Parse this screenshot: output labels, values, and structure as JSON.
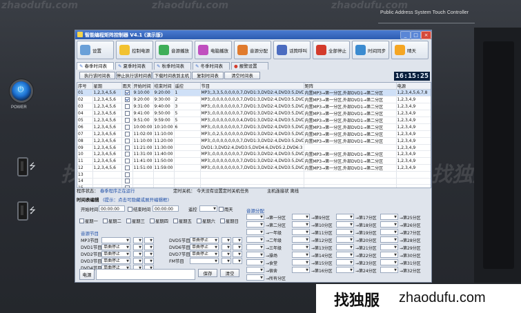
{
  "device": {
    "title": "Public Address System Touch Controller",
    "power_label": "POWER"
  },
  "watermarks": {
    "site": "zhaodufu.com",
    "brand": "找独服"
  },
  "window": {
    "title": "智能编程矩阵控制器 V4.1 (演示版)"
  },
  "toolbar": [
    {
      "label": "设置",
      "icon": "gear-icon",
      "color": "#6aa0d8"
    },
    {
      "label": "控制电源",
      "icon": "bulb-icon",
      "color": "#f2c230"
    },
    {
      "label": "音源播放",
      "icon": "music-icon",
      "color": "#3fae59"
    },
    {
      "label": "电脑播放",
      "icon": "disc-icon",
      "color": "#c04fbf"
    },
    {
      "label": "音源分配",
      "icon": "distribute-icon",
      "color": "#e07b2e"
    },
    {
      "label": "话筒呼叫",
      "icon": "microphone-icon",
      "color": "#4b6cc0"
    },
    {
      "label": "全部停止",
      "icon": "stop-icon",
      "color": "#d33b2c"
    },
    {
      "label": "时间同步",
      "icon": "clock-icon",
      "color": "#3b8bd0"
    },
    {
      "label": "晴天",
      "icon": "sun-icon",
      "color": "#f5a623"
    }
  ],
  "tabs": [
    {
      "label": "春季时间表",
      "active": true
    },
    {
      "label": "夏季时间表",
      "active": false
    },
    {
      "label": "秋季时间表",
      "active": false
    },
    {
      "label": "冬季时间表",
      "active": false
    },
    {
      "label": "报警设置",
      "active": false
    }
  ],
  "actions": [
    "执行该时间表",
    "停止执行该时间表",
    "下载时间表到主机",
    "复制时间表",
    "清空时间表"
  ],
  "clock": "16:15:25",
  "schedule": {
    "columns": [
      "序号",
      "星期",
      "雨天",
      "开始时间",
      "结束时间",
      "遥控",
      "节目",
      "矩阵",
      "电源"
    ],
    "rows": [
      {
        "no": "01",
        "week": "1,2,3,4,5,6",
        "rain": true,
        "start": "9:10:00",
        "end": "9:20:00",
        "remote": "1",
        "program": "MP3;,3,3,5,0,0,0,0,7,DVD1:3,DVD2:4,DVD3:5,DVD4:6,DVD5:7",
        "matrix": "内置MP3→第一分区,外部DVD1→第二分区",
        "power": "1,2,3,4,5,6,7,8"
      },
      {
        "no": "02",
        "week": "1,2,3,4,5,6",
        "rain": true,
        "start": "9:20:00",
        "end": "9:30:00",
        "remote": "2",
        "program": "MP3;,0,0,0,0,0,0,0,7,DVD1:3,DVD2:4,DVD3:5,DVD4:6,DVD5:7",
        "matrix": "内置MP3→第一分区,外部DVD1→第二分区",
        "power": "1,2,3,4,9"
      },
      {
        "no": "03",
        "week": "1,2,3,4,5,6",
        "rain": false,
        "start": "9:31:00",
        "end": "9:40:00",
        "remote": "3",
        "program": "MP3;,0,0,0,0,0,0,0,7,DVD1:3,DVD2:4,DVD3:5,DVD4:6,DVD5:2",
        "matrix": "内置MP3→第一分区,外部DVD1→第二分区",
        "power": "1,2,3,4,9"
      },
      {
        "no": "04",
        "week": "1,2,3,4,5,6",
        "rain": false,
        "start": "9:41:00",
        "end": "9:50:00",
        "remote": "5",
        "program": "MP3;,0,0,0,0,0,0,0,7,DVD1:3,DVD2:4,DVD3:5,DVD4:6,DVD5:2",
        "matrix": "内置MP3→第一分区,外部DVD1→第二分区",
        "power": "1,2,3,4,9"
      },
      {
        "no": "05",
        "week": "1,2,3,4,5,6",
        "rain": false,
        "start": "9:51:00",
        "end": "9:59:00",
        "remote": "5",
        "program": "MP3;,0,0,0,0,0,0,0,4,DVD1:3,DVD2:4,DVD3:5,DVD4:6,DVD5:2",
        "matrix": "内置MP3→第一分区,外部DVD1→第二分区",
        "power": "1,2,3,4,9"
      },
      {
        "no": "06",
        "week": "1,2,3,4,5,6",
        "rain": false,
        "start": "10:00:00",
        "end": "10:10:00",
        "remote": "6",
        "program": "MP3;,0,0,0,0,0,0,0,7,DVD1:3,DVD2:4,DVD3:5,DVD4:6,DVD5:2",
        "matrix": "内置MP3→第一分区,外部DVD1→第二分区",
        "power": "1,2,3,4,9"
      },
      {
        "no": "07",
        "week": "1,2,3,4,5,6",
        "rain": false,
        "start": "11:02:00",
        "end": "11:10:00",
        "remote": "",
        "program": "MP3;,0,2,5,0,0,0,0,0,DVD1:3,DVD2:4,DVD3:5,DVD4:6,DVD5:2",
        "matrix": "内置MP3→第一分区,外部DVD1→第二分区",
        "power": "1,2,3,4,9"
      },
      {
        "no": "08",
        "week": "1,2,3,4,5,6",
        "rain": false,
        "start": "11:10:00",
        "end": "11:20:00",
        "remote": "",
        "program": "MP3;,0,0,0,0,0,0,0,7,DVD1:3,DVD2:4,DVD3:5,DVD4:6,DVD5:2",
        "matrix": "内置MP3→第一分区,外部DVD1→第二分区",
        "power": "1,2,3,4,9"
      },
      {
        "no": "09",
        "week": "1,2,3,4,5,6",
        "rain": false,
        "start": "11:21:00",
        "end": "11:30:00",
        "remote": "",
        "program": "DVD1:3,DVD2:4,DVD3:5,DVD4:6,DVD5:2,DVD6:3",
        "matrix": "",
        "power": "1,2,3,4,9"
      },
      {
        "no": "10",
        "week": "1,2,3,4,5,6",
        "rain": false,
        "start": "11:31:00",
        "end": "11:40:00",
        "remote": "",
        "program": "MP3;,0,0,0,0,0,0,0,7,DVD1:3,DVD2:4,DVD3:5,DVD4:6,DVD5:2",
        "matrix": "内置MP3→第一分区,外部DVD1→第二分区",
        "power": "1,2,3,4,9"
      },
      {
        "no": "11",
        "week": "1,2,3,4,5,6",
        "rain": false,
        "start": "11:41:00",
        "end": "11:50:00",
        "remote": "",
        "program": "MP3;,0,0,0,0,0,0,0,7,DVD1:3,DVD2:4,DVD3:5,DVD4:6,DVD5:2",
        "matrix": "内置MP3→第一分区,外部DVD1→第二分区",
        "power": "1,2,3,4,9"
      },
      {
        "no": "12",
        "week": "1,2,3,4,5,6",
        "rain": false,
        "start": "11:51:00",
        "end": "11:59:00",
        "remote": "",
        "program": "MP3;,0,0,0,0,0,0,0,7,DVD1:3,DVD2:4,DVD3:5,DVD4:6,DVD5:2",
        "matrix": "内置MP3→第一分区,外部DVD1→第二分区",
        "power": "1,2,3,4,9"
      },
      {
        "no": "13",
        "week": "",
        "rain": false,
        "start": "",
        "end": "",
        "remote": "",
        "program": "",
        "matrix": "",
        "power": ""
      },
      {
        "no": "14",
        "week": "",
        "rain": false,
        "start": "",
        "end": "",
        "remote": "",
        "program": "",
        "matrix": "",
        "power": ""
      },
      {
        "no": "15",
        "week": "",
        "rain": false,
        "start": "",
        "end": "",
        "remote": "",
        "program": "",
        "matrix": "",
        "power": ""
      }
    ]
  },
  "status": {
    "program_status": "程序状态：",
    "program_value": "春季程序正在运行",
    "timer_off": "定时关机：",
    "timer_value": "今天没有设置定时关机任务",
    "host_link": "主机连接状 离线"
  },
  "editor": {
    "title": "时间表编辑",
    "hint": "(提示：点击可隐藏或展开编辑框)",
    "start_label": "开始时间",
    "start_value": "00:00:00",
    "end_check": "结束时间",
    "end_value": "00:00:00",
    "remote_label": "遥控",
    "rain_label": "雨天",
    "weekdays": [
      "星期一",
      "星期二",
      "星期三",
      "星期四",
      "星期五",
      "星期六",
      "星期日"
    ],
    "source_title": "音源节目",
    "sources_left": [
      {
        "label": "MP3节目",
        "value": ""
      },
      {
        "label": "DVD1节目",
        "value": "单曲停止"
      },
      {
        "label": "DVD2节目",
        "value": "单曲停止"
      },
      {
        "label": "DVD3节目",
        "value": "单曲停止"
      },
      {
        "label": "DVD4节目",
        "value": "单曲停止"
      }
    ],
    "sources_right": [
      {
        "label": "DVD5节目",
        "value": "单曲停止"
      },
      {
        "label": "DVD6节目",
        "value": "单曲停止"
      },
      {
        "label": "DVD7节目",
        "value": "单曲停止"
      },
      {
        "label": "FM节目",
        "value": ""
      }
    ],
    "power_button": "电源",
    "save_button": "保存",
    "clear_button": "清空"
  },
  "distribution": {
    "title": "音源分配",
    "col1": [
      "第一分区",
      "第二分区",
      "一年级",
      "二年级",
      "三年级",
      "操场",
      "食堂",
      "宿舍",
      "所有分区"
    ],
    "col2": [
      "第9分区",
      "第10分区",
      "第11分区",
      "第12分区",
      "第13分区",
      "第14分区",
      "第15分区",
      "第16分区"
    ],
    "col3": [
      "第17分区",
      "第18分区",
      "第19分区",
      "第20分区",
      "第21分区",
      "第22分区",
      "第23分区",
      "第24分区"
    ],
    "col4": [
      "第25分区",
      "第26分区",
      "第27分区",
      "第28分区",
      "第29分区",
      "第30分区",
      "第31分区",
      "第32分区"
    ]
  },
  "banner": {
    "brand": "找独服",
    "site": "zhaodufu.com"
  }
}
